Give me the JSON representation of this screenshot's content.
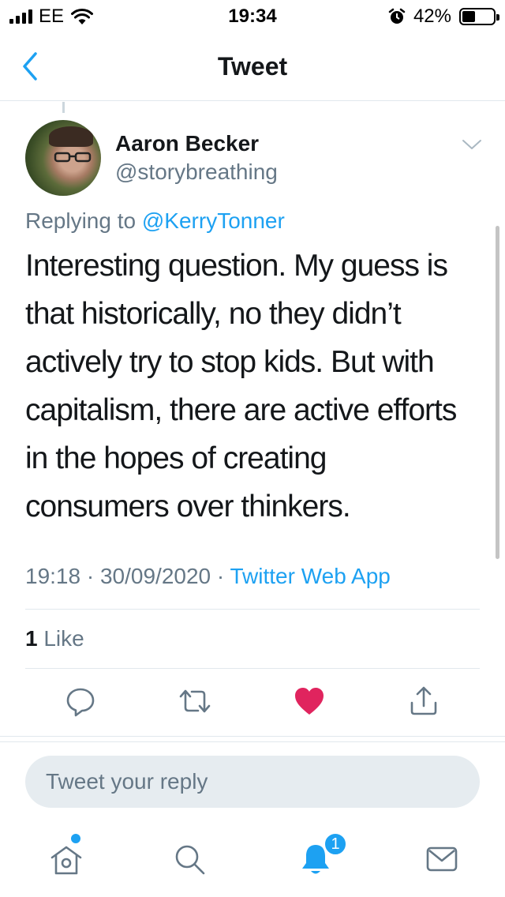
{
  "status_bar": {
    "carrier": "EE",
    "time": "19:34",
    "battery_percent": "42%",
    "battery_level": 0.42
  },
  "nav": {
    "title": "Tweet",
    "back_icon": "chevron-left-icon"
  },
  "tweet": {
    "author_name": "Aaron Becker",
    "author_handle": "@storybreathing",
    "replying_prefix": "Replying to",
    "replying_to": "@KerryTonner",
    "text_lines": [
      "Interesting question. My guess is",
      "that historically, no they didn’t",
      "actively try to stop kids. But with",
      "capitalism, there are active efforts",
      "in the hopes of creating",
      "consumers over thinkers."
    ],
    "time": "19:18",
    "date": "30/09/2020",
    "separator": "·",
    "source": "Twitter Web App",
    "like_count": "1",
    "like_label": "Like"
  },
  "actions": [
    "reply-icon",
    "retweet-icon",
    "heart-icon",
    "share-icon"
  ],
  "reply": {
    "placeholder": "Tweet your reply"
  },
  "tab_bar": {
    "items": [
      "home-icon",
      "search-icon",
      "notifications-icon",
      "messages-icon"
    ],
    "notifications_badge": "1"
  },
  "colors": {
    "accent": "#1da1f2",
    "like": "#e0245e",
    "secondary_text": "#657786"
  }
}
